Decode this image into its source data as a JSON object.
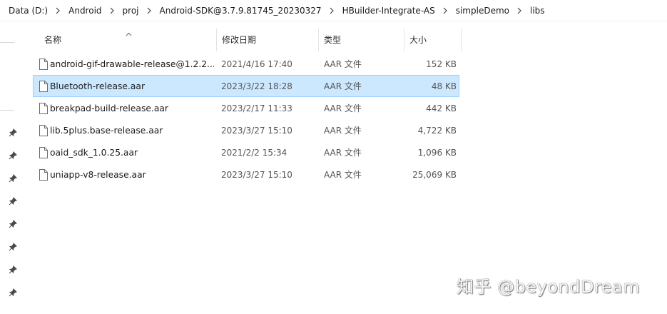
{
  "breadcrumb": [
    "Data (D:)",
    "Android",
    "proj",
    "Android-SDK@3.7.9.81745_20230327",
    "HBuilder-Integrate-AS",
    "simpleDemo",
    "libs"
  ],
  "columns": {
    "name": "名称",
    "date": "修改日期",
    "type": "类型",
    "size": "大小"
  },
  "files": [
    {
      "name": "android-gif-drawable-release@1.2.2...",
      "date": "2021/4/16 17:40",
      "type": "AAR 文件",
      "size": "152 KB",
      "selected": false
    },
    {
      "name": "Bluetooth-release.aar",
      "date": "2023/3/22 18:28",
      "type": "AAR 文件",
      "size": "48 KB",
      "selected": true
    },
    {
      "name": "breakpad-build-release.aar",
      "date": "2023/2/17 11:33",
      "type": "AAR 文件",
      "size": "442 KB",
      "selected": false
    },
    {
      "name": "lib.5plus.base-release.aar",
      "date": "2023/3/27 15:10",
      "type": "AAR 文件",
      "size": "4,722 KB",
      "selected": false
    },
    {
      "name": "oaid_sdk_1.0.25.aar",
      "date": "2021/2/2 15:34",
      "type": "AAR 文件",
      "size": "1,096 KB",
      "selected": false
    },
    {
      "name": "uniapp-v8-release.aar",
      "date": "2023/3/27 15:10",
      "type": "AAR 文件",
      "size": "25,069 KB",
      "selected": false
    }
  ],
  "watermark": "知乎 @beyondDream",
  "colors": {
    "selection_bg": "#cce8ff",
    "selection_border": "#99d1ff"
  },
  "icons": {
    "file": "file-icon",
    "pin": "pin-icon",
    "separator": "chevron-right-icon",
    "sort": "chevron-up-icon"
  }
}
